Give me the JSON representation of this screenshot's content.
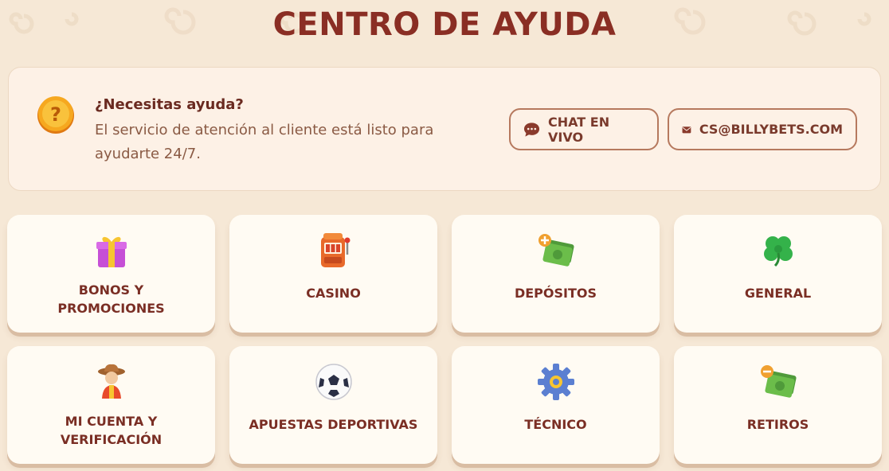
{
  "page_title": "CENTRO DE AYUDA",
  "help": {
    "heading": "¿Necesitas ayuda?",
    "text": "El servicio de atención al cliente está listo para ayudarte 24/7.",
    "icon": "question-coin-icon"
  },
  "contacts": [
    {
      "label": "CHAT EN VIVO",
      "icon": "chat-icon"
    },
    {
      "label": "CS@BILLYBETS.COM",
      "icon": "mail-icon"
    }
  ],
  "categories": [
    {
      "label_line1": "BONOS Y",
      "label_line2": "PROMOCIONES",
      "icon": "gift-icon"
    },
    {
      "label_line1": "CASINO",
      "label_line2": "",
      "icon": "slot-machine-icon"
    },
    {
      "label_line1": "DEPÓSITOS",
      "label_line2": "",
      "icon": "cash-plus-icon"
    },
    {
      "label_line1": "GENERAL",
      "label_line2": "",
      "icon": "clover-icon"
    },
    {
      "label_line1": "MI CUENTA Y",
      "label_line2": "VERIFICACIÓN",
      "icon": "cowboy-icon"
    },
    {
      "label_line1": "APUESTAS DEPORTIVAS",
      "label_line2": "",
      "icon": "soccer-ball-icon"
    },
    {
      "label_line1": "TÉCNICO",
      "label_line2": "",
      "icon": "gear-icon"
    },
    {
      "label_line1": "RETIROS",
      "label_line2": "",
      "icon": "cash-minus-icon"
    }
  ],
  "colors": {
    "background": "#f6e8d6",
    "title": "#8a2e24",
    "panel": "#fdf1e6",
    "card": "#fffbf3",
    "button_border": "#b6795e"
  }
}
